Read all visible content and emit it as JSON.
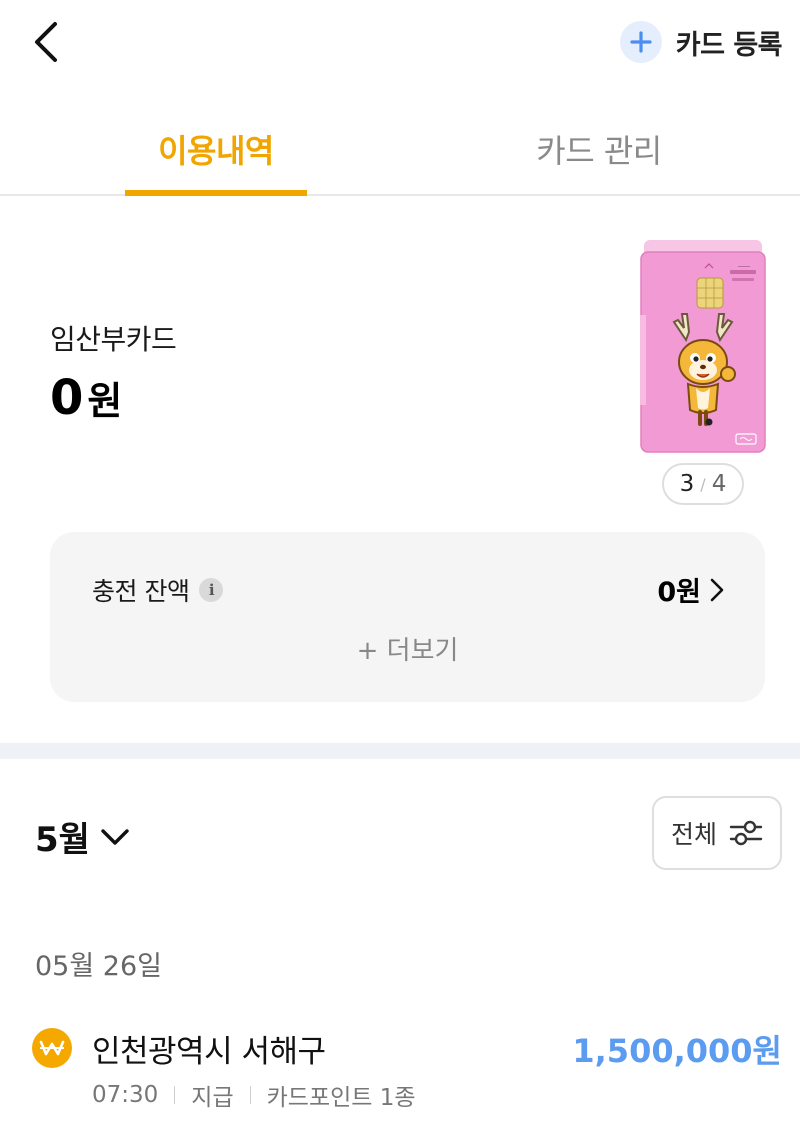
{
  "header": {
    "back_icon": "chevron-left-icon",
    "register": {
      "icon": "plus-icon",
      "label": "카드 등록"
    }
  },
  "tabs": [
    {
      "label": "이용내역",
      "active": true
    },
    {
      "label": "카드 관리",
      "active": false
    }
  ],
  "card": {
    "name": "임산부카드",
    "amount_number": "0",
    "amount_unit": "원",
    "pager": {
      "current": "3",
      "total": "4"
    },
    "colors": {
      "card": "#f19ad4",
      "card_back": "#f7c6e4"
    }
  },
  "balance": {
    "label": "충전 잔액",
    "info_icon": "info-icon",
    "amount": "0원",
    "more_label": "+ 더보기"
  },
  "list": {
    "month": "5월",
    "filter_label": "전체",
    "filter_icon": "sliders-icon",
    "groups": [
      {
        "date": "05월 26일",
        "items": [
          {
            "icon": "won-coin-icon",
            "title": "인천광역시 서해구",
            "amount": "1,500,000원",
            "time": "07:30",
            "type": "지급",
            "category": "카드포인트 1종"
          }
        ]
      }
    ]
  },
  "colors": {
    "accent": "#f0a500",
    "amount_blue": "#5b9bf0"
  }
}
